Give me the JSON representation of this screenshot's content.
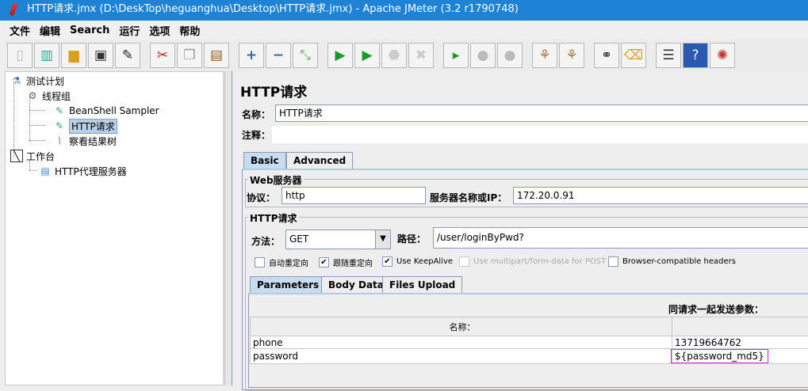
{
  "window": {
    "title": "HTTP请求.jmx (D:\\DeskTop\\heguanghua\\Desktop\\HTTP请求.jmx) - Apache JMeter (3.2 r1790748)"
  },
  "menu": [
    "文件",
    "编辑",
    "Search",
    "运行",
    "选项",
    "帮助"
  ],
  "toolbar": [
    [
      "new-icon",
      "open-templates-icon",
      "open-icon",
      "save-icon",
      "save-as-icon"
    ],
    [
      "cut-icon",
      "copy-icon",
      "paste-icon"
    ],
    [
      "expand-icon",
      "collapse-icon",
      "toggle-icon"
    ],
    [
      "start-icon",
      "start-no-pause-icon",
      "stop-icon",
      "shutdown-icon"
    ],
    [
      "remote-start-icon",
      "remote-stop-icon",
      "remote-shutdown-icon"
    ],
    [
      "clear-icon",
      "clear-all-icon"
    ],
    [
      "search-icon",
      "reset-search-icon"
    ],
    [
      "function-helper-icon",
      "help-icon",
      "log-icon"
    ]
  ],
  "tree": {
    "test_plan": "测试计划",
    "thread_group": "线程组",
    "beanshell": "BeanShell Sampler",
    "http_request": "HTTP请求",
    "result_tree": "察看结果树",
    "workbench": "工作台",
    "proxy": "HTTP代理服务器"
  },
  "panel": {
    "title": "HTTP请求",
    "name_label": "名称：",
    "name_value": "HTTP请求",
    "comment_label": "注释：",
    "comment_value": "",
    "tabs": [
      "Basic",
      "Advanced"
    ],
    "web_server": {
      "legend": "Web服务器",
      "protocol_label": "协议：",
      "protocol_value": "http",
      "server_label": "服务器名称或IP：",
      "server_value": "172.20.0.91"
    },
    "http_request": {
      "legend": "HTTP请求",
      "method_label": "方法：",
      "method_value": "GET",
      "path_label": "路径：",
      "path_value": "/user/loginByPwd?"
    },
    "checkboxes": [
      {
        "label": "自动重定向",
        "checked": false
      },
      {
        "label": "跟随重定向",
        "checked": true
      },
      {
        "label": "Use KeepAlive",
        "checked": true
      },
      {
        "label": "Use multipart/form-data for POST",
        "checked": false
      },
      {
        "label": "Browser-compatible headers",
        "checked": false
      }
    ],
    "sub_tabs": [
      "Parameters",
      "Body Data",
      "Files Upload"
    ],
    "params_title": "同请求一起发送参数：",
    "columns": [
      "名称：",
      ""
    ],
    "rows": [
      [
        "phone",
        "13719664762"
      ],
      [
        "password",
        "${password_md5}"
      ]
    ]
  }
}
